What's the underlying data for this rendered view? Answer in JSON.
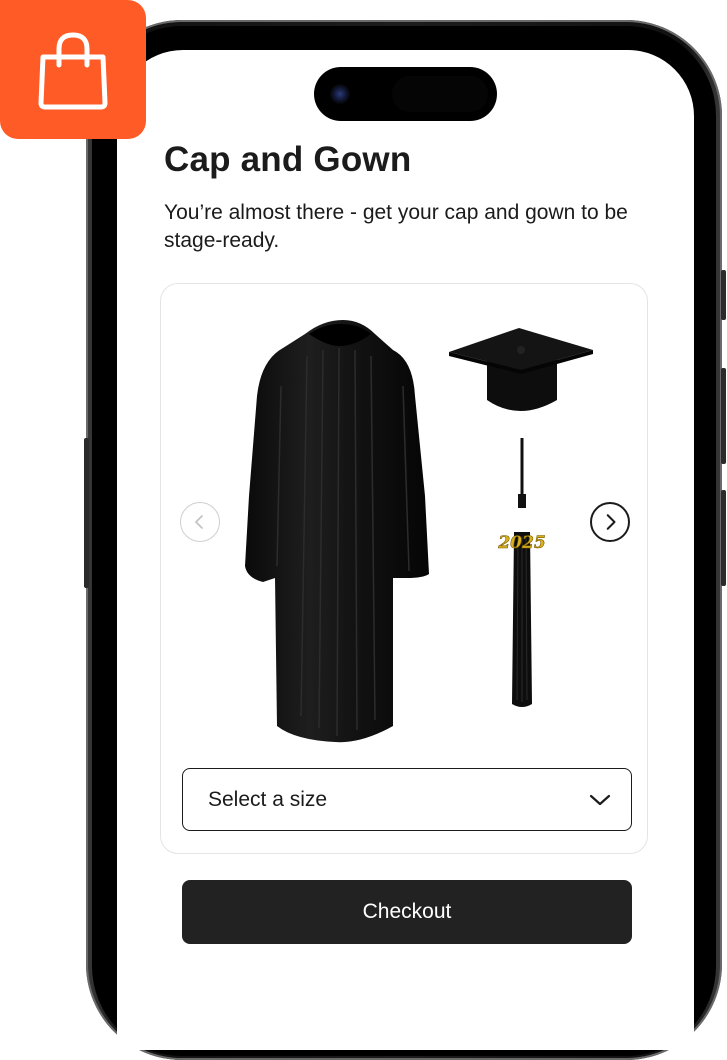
{
  "app": {
    "icon": "shopping-bag-icon",
    "badge_color": "#ff5b26"
  },
  "page": {
    "title": "Cap and Gown",
    "subtitle": "You’re almost there - get your cap and gown to be stage-ready."
  },
  "product": {
    "images": [
      "graduation-gown",
      "graduation-cap",
      "graduation-tassel"
    ],
    "tassel_year": "2025",
    "carousel": {
      "prev_icon": "chevron-left-icon",
      "next_icon": "chevron-right-icon"
    }
  },
  "size_select": {
    "label": "Select a size",
    "icon": "chevron-down-icon"
  },
  "actions": {
    "checkout_label": "Checkout",
    "checkout_color": "#222222"
  }
}
